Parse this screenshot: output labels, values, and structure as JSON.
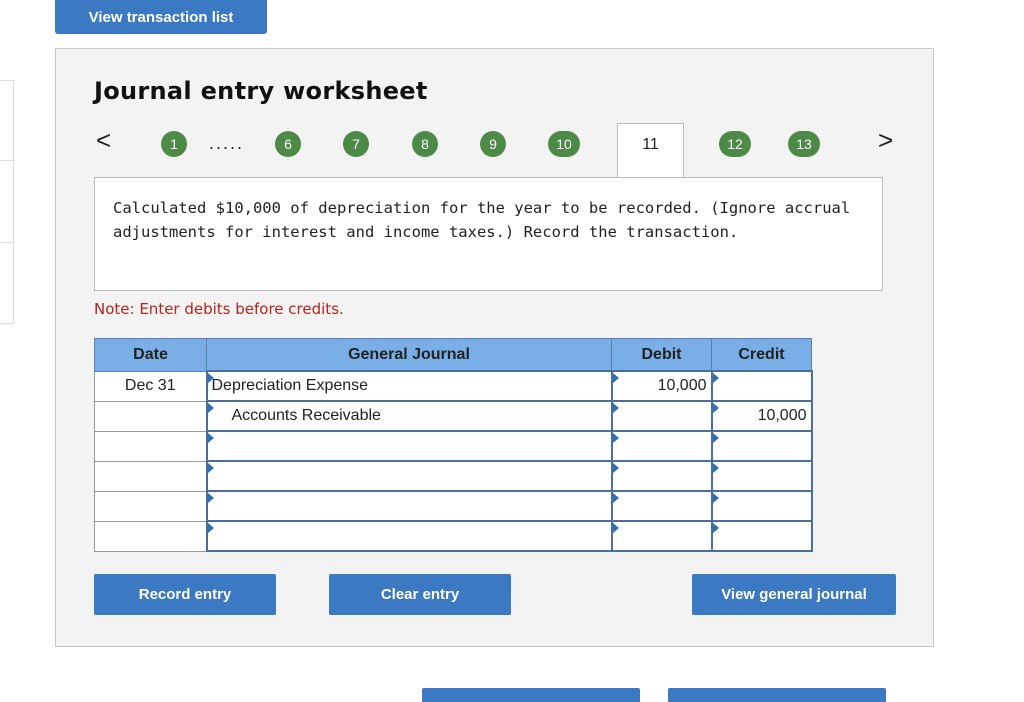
{
  "top_button": "View transaction list",
  "worksheet": {
    "title": "Journal entry worksheet",
    "nav": {
      "prev": "<",
      "next": ">",
      "ellipsis": ".....",
      "steps": [
        "1",
        "6",
        "7",
        "8",
        "9",
        "10",
        "11",
        "12",
        "13"
      ],
      "current": "11"
    },
    "description": "Calculated $10,000 of depreciation for the year to be recorded. (Ignore accrual adjustments for interest and income taxes.) Record the transaction.",
    "note": "Note: Enter debits before credits.",
    "table": {
      "headers": [
        "Date",
        "General Journal",
        "Debit",
        "Credit"
      ],
      "rows": [
        {
          "date": "Dec 31",
          "account": "Depreciation Expense",
          "debit": "10,000",
          "credit": ""
        },
        {
          "date": "",
          "account": "Accounts Receivable",
          "debit": "",
          "credit": "10,000"
        },
        {
          "date": "",
          "account": "",
          "debit": "",
          "credit": ""
        },
        {
          "date": "",
          "account": "",
          "debit": "",
          "credit": ""
        },
        {
          "date": "",
          "account": "",
          "debit": "",
          "credit": ""
        },
        {
          "date": "",
          "account": "",
          "debit": "",
          "credit": ""
        }
      ]
    },
    "buttons": {
      "record": "Record entry",
      "clear": "Clear entry",
      "view_general_journal": "View general journal"
    }
  },
  "colors": {
    "button": "#3b79c2",
    "step": "#4e8a47",
    "table_header": "#7aaee6",
    "note": "#b3261e"
  }
}
